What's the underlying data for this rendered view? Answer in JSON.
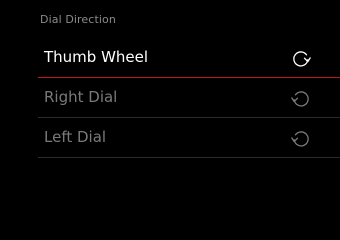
{
  "header": {
    "title": "Dial Direction"
  },
  "menu": {
    "items": [
      {
        "label": "Thumb Wheel",
        "icon": "rotate-clockwise-icon",
        "selected": true
      },
      {
        "label": "Right Dial",
        "icon": "rotate-counterclockwise-icon",
        "selected": false
      },
      {
        "label": "Left Dial",
        "icon": "rotate-counterclockwise-icon",
        "selected": false
      }
    ]
  },
  "colors": {
    "background": "#000000",
    "accent": "#c2161d",
    "text_selected": "#ffffff",
    "text_inactive": "#7a7a7a",
    "title": "#8a8a8a",
    "divider": "#2a2a2a"
  }
}
